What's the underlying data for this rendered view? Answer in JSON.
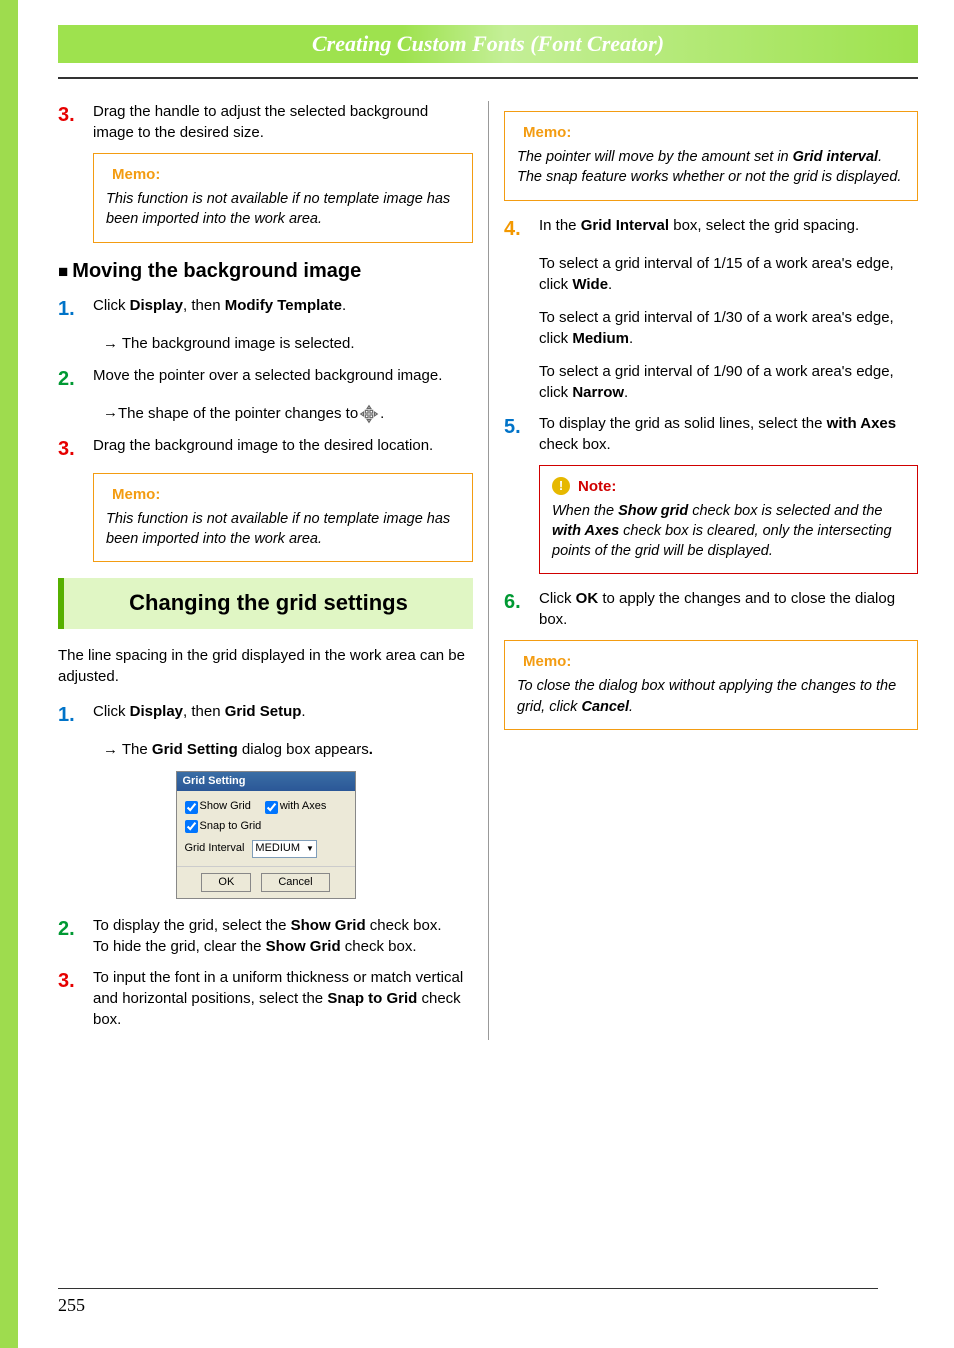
{
  "banner": "Creating Custom Fonts (Font Creator)",
  "pageNumber": "255",
  "left": {
    "step3": {
      "num": "3.",
      "text": "Drag the handle to adjust the selected background image to the desired size."
    },
    "memo1": {
      "label": "Memo:",
      "text": "This function is not available if no template image has been imported into the work area."
    },
    "subhead": "Moving the background image",
    "mv1": {
      "num": "1.",
      "pre": "Click ",
      "b1": "Display",
      "mid": ", then ",
      "b2": "Modify Template",
      "post": "."
    },
    "mv1sub": " The background image is selected.",
    "mv2": {
      "num": "2.",
      "text": "Move the pointer over a selected background image."
    },
    "mv2sub": " The shape of the pointer changes to ",
    "mv3": {
      "num": "3.",
      "text": "Drag the background image to the desired location."
    },
    "memo2": {
      "label": "Memo:",
      "text": "This function is not available if no template image has been imported into the work area."
    },
    "section": "Changing the grid settings",
    "intro": "The line spacing in the grid displayed in the work area can be adjusted.",
    "g1": {
      "num": "1.",
      "pre": "Click ",
      "b1": "Display",
      "mid": ", then ",
      "b2": "Grid Setup",
      "post": "."
    },
    "g1sub_pre": " The ",
    "g1sub_b": "Grid Setting",
    "g1sub_post": " dialog box appears",
    "dlg": {
      "title": "Grid Setting",
      "showGrid": "Show Grid",
      "withAxes": "with Axes",
      "snap": "Snap to Grid",
      "intervalLabel": "Grid Interval",
      "intervalValue": "MEDIUM",
      "ok": "OK",
      "cancel": "Cancel"
    },
    "g2": {
      "num": "2.",
      "pre": "To display the grid, select the ",
      "b1": "Show Grid",
      "mid": " check box.",
      "line2_pre": "To hide the grid, clear the ",
      "line2_b": "Show Grid",
      "line2_post": " check box."
    },
    "g3": {
      "num": "3.",
      "pre": "To input the font in a uniform thickness or match vertical and horizontal positions, select the ",
      "b1": "Snap to Grid",
      "post": " check box."
    }
  },
  "right": {
    "memo1": {
      "label": "Memo:",
      "line1_pre": "The pointer will move by the amount set in ",
      "line1_b": "Grid interval",
      "line1_post": ".",
      "line2": "The snap feature works whether or not the grid is displayed."
    },
    "r4": {
      "num": "4.",
      "pre": "In the ",
      "b1": "Grid Interval",
      "post": " box, select the grid spacing.",
      "wide_pre": "To select a grid interval of 1/15 of a work area's edge, click ",
      "wide_b": "Wide",
      "medium_pre": "To select a grid interval of 1/30 of a work area's edge, click ",
      "medium_b": "Medium",
      "narrow_pre": "To select a grid interval of 1/90 of a work area's edge, click ",
      "narrow_b": "Narrow"
    },
    "r5": {
      "num": "5.",
      "pre": "To display the grid as solid lines, select the ",
      "b1": "with Axes",
      "post": " check box."
    },
    "note": {
      "label": "Note:",
      "pre": "When the ",
      "b1": "Show grid",
      "mid1": " check box is selected and the ",
      "b2": "with Axes",
      "post": " check box is cleared, only the intersecting points of the grid will be displayed."
    },
    "r6": {
      "num": "6.",
      "pre": "Click ",
      "b1": "OK",
      "post": " to apply the changes and to close the dialog box."
    },
    "memo2": {
      "label": "Memo:",
      "pre": "To close the dialog box without applying the changes to the grid, click ",
      "b1": "Cancel",
      "post": "."
    }
  }
}
